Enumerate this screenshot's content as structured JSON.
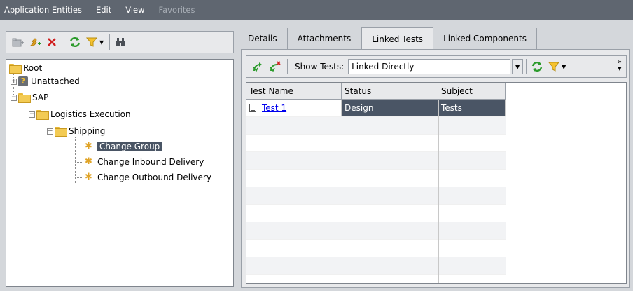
{
  "menubar": {
    "items": [
      {
        "label": "Application Entities",
        "enabled": true
      },
      {
        "label": "Edit",
        "enabled": true
      },
      {
        "label": "View",
        "enabled": true
      },
      {
        "label": "Favorites",
        "enabled": false
      }
    ]
  },
  "left_toolbar": {
    "icons": [
      "new-folder-icon",
      "new-entity-icon",
      "delete-icon",
      "refresh-icon",
      "filter-icon",
      "find-icon"
    ]
  },
  "tree": {
    "root": "Root",
    "unattached": "Unattached",
    "sap": "SAP",
    "logistics": "Logistics Execution",
    "shipping": "Shipping",
    "change_group": "Change Group",
    "change_inbound": "Change Inbound Delivery",
    "change_outbound": "Change Outbound Delivery",
    "selected": "Change Group"
  },
  "tabs": [
    {
      "label": "Details",
      "active": false
    },
    {
      "label": "Attachments",
      "active": false
    },
    {
      "label": "Linked Tests",
      "active": true
    },
    {
      "label": "Linked Components",
      "active": false
    }
  ],
  "right_toolbar": {
    "show_tests_label": "Show Tests:",
    "show_tests_value": "Linked Directly"
  },
  "grid": {
    "columns": [
      "Test Name",
      "Status",
      "Subject"
    ],
    "rows": [
      {
        "name": "Test 1",
        "status": "Design",
        "subject": "Tests",
        "selected": true
      }
    ]
  },
  "colors": {
    "menubar_bg": "#5f6670",
    "selection_bg": "#4a5565",
    "link": "#0000ee"
  }
}
